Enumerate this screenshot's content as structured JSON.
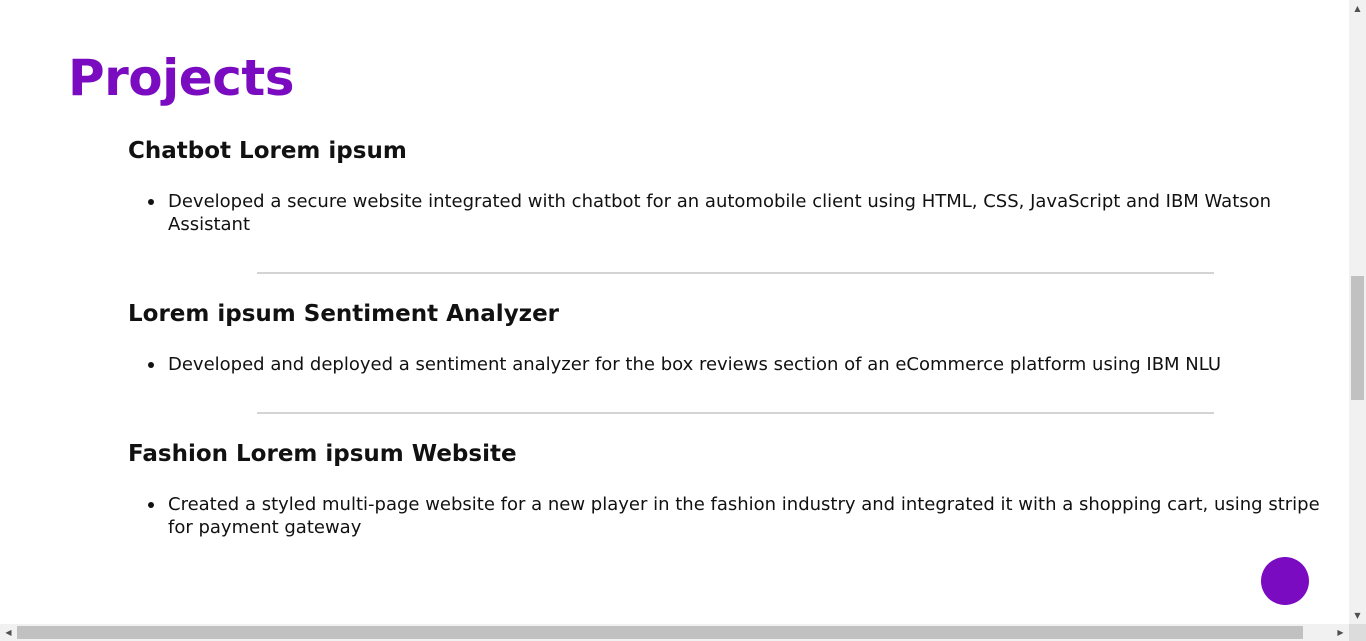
{
  "section": {
    "title": "Projects"
  },
  "projects": [
    {
      "title": "Chatbot Lorem ipsum",
      "bullets": [
        "Developed a secure website integrated with chatbot for an automobile client using HTML, CSS, JavaScript and IBM Watson Assistant"
      ]
    },
    {
      "title": "Lorem ipsum Sentiment Analyzer",
      "bullets": [
        "Developed and deployed a sentiment analyzer for the box reviews section of an eCommerce platform using IBM NLU"
      ]
    },
    {
      "title": "Fashion Lorem ipsum Website",
      "bullets": [
        "Created a styled multi-page website for a new player in the fashion industry and integrated it with a shopping cart, using stripe for payment gateway"
      ]
    }
  ],
  "colors": {
    "accent": "#7a0bc0",
    "divider": "#d4d4d4"
  },
  "icons": {
    "fab": "purple-circle-button",
    "scroll_up": "triangle-up-icon",
    "scroll_down": "triangle-down-icon",
    "scroll_left": "triangle-left-icon",
    "scroll_right": "triangle-right-icon"
  }
}
